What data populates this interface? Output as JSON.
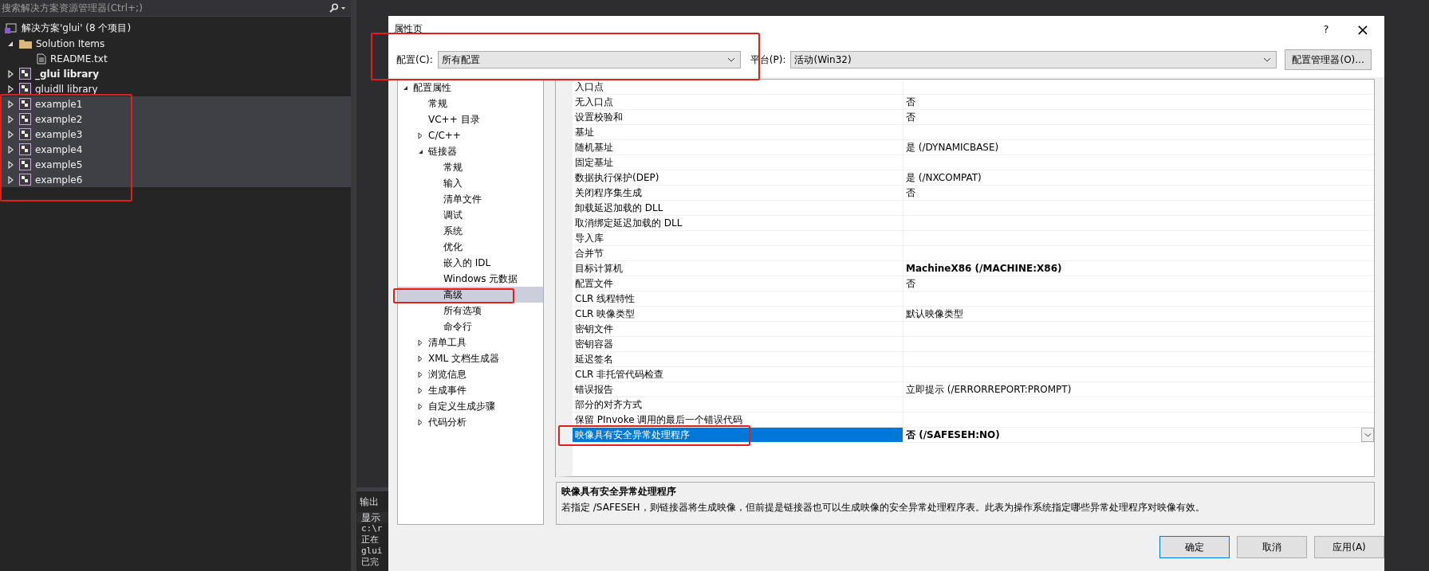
{
  "solution_explorer": {
    "search": {
      "placeholder": "搜索解决方案资源管理器(Ctrl+;)"
    },
    "tree": [
      {
        "label": "解决方案'glui' (8 个项目)",
        "kind": "solution",
        "bold": false,
        "selected": false,
        "children": [
          {
            "label": "Solution Items",
            "kind": "folder",
            "expanded": true,
            "bold": false,
            "selected": false,
            "children": [
              {
                "label": "README.txt",
                "kind": "file",
                "bold": false,
                "selected": false
              }
            ]
          },
          {
            "label": "_glui library",
            "kind": "project",
            "expanded": false,
            "bold": true,
            "selected": false
          },
          {
            "label": "gluidll library",
            "kind": "project",
            "expanded": false,
            "bold": false,
            "selected": false
          },
          {
            "label": "example1",
            "kind": "project",
            "expanded": false,
            "bold": false,
            "selected": true
          },
          {
            "label": "example2",
            "kind": "project",
            "expanded": false,
            "bold": false,
            "selected": true
          },
          {
            "label": "example3",
            "kind": "project",
            "expanded": false,
            "bold": false,
            "selected": true
          },
          {
            "label": "example4",
            "kind": "project",
            "expanded": false,
            "bold": false,
            "selected": true
          },
          {
            "label": "example5",
            "kind": "project",
            "expanded": false,
            "bold": false,
            "selected": true
          },
          {
            "label": "example6",
            "kind": "project",
            "expanded": false,
            "bold": false,
            "selected": true
          }
        ]
      }
    ]
  },
  "output_panel": {
    "title": "输出",
    "lines": [
      "显示",
      "c:\\r",
      "正在",
      "glui",
      "已完"
    ]
  },
  "dialog": {
    "title": "属性页",
    "help": "?",
    "close": "×",
    "configuration": {
      "label": "配置(C):",
      "value": "所有配置"
    },
    "platform": {
      "label": "平台(P):",
      "value": "活动(Win32)"
    },
    "manager_button": "配置管理器(O)...",
    "tree": [
      {
        "label": "配置属性",
        "expanded": true,
        "selected": false,
        "children": [
          {
            "label": "常规",
            "selected": false
          },
          {
            "label": "VC++ 目录",
            "selected": false
          },
          {
            "label": "C/C++",
            "expanded": false,
            "selected": false
          },
          {
            "label": "链接器",
            "expanded": true,
            "selected": false,
            "children": [
              {
                "label": "常规",
                "selected": false
              },
              {
                "label": "输入",
                "selected": false
              },
              {
                "label": "清单文件",
                "selected": false
              },
              {
                "label": "调试",
                "selected": false
              },
              {
                "label": "系统",
                "selected": false
              },
              {
                "label": "优化",
                "selected": false
              },
              {
                "label": "嵌入的 IDL",
                "selected": false
              },
              {
                "label": "Windows 元数据",
                "selected": false
              },
              {
                "label": "高级",
                "selected": true
              },
              {
                "label": "所有选项",
                "selected": false
              },
              {
                "label": "命令行",
                "selected": false
              }
            ]
          },
          {
            "label": "清单工具",
            "expanded": false,
            "selected": false
          },
          {
            "label": "XML 文档生成器",
            "expanded": false,
            "selected": false
          },
          {
            "label": "浏览信息",
            "expanded": false,
            "selected": false
          },
          {
            "label": "生成事件",
            "expanded": false,
            "selected": false
          },
          {
            "label": "自定义生成步骤",
            "expanded": false,
            "selected": false
          },
          {
            "label": "代码分析",
            "expanded": false,
            "selected": false
          }
        ]
      }
    ],
    "properties": [
      {
        "name": "入口点",
        "selected": false
      },
      {
        "name": "无入口点",
        "value": "否",
        "modified": false,
        "selected": false
      },
      {
        "name": "设置校验和",
        "value": "否",
        "modified": false,
        "selected": false
      },
      {
        "name": "基址",
        "selected": false
      },
      {
        "name": "随机基址",
        "value": "是 (/DYNAMICBASE)",
        "modified": false,
        "selected": false
      },
      {
        "name": "固定基址",
        "selected": false
      },
      {
        "name": "数据执行保护(DEP)",
        "value": "是 (/NXCOMPAT)",
        "modified": false,
        "selected": false
      },
      {
        "name": "关闭程序集生成",
        "value": "否",
        "modified": false,
        "selected": false
      },
      {
        "name": "卸载延迟加载的 DLL",
        "selected": false
      },
      {
        "name": "取消绑定延迟加载的 DLL",
        "selected": false
      },
      {
        "name": "导入库",
        "selected": false
      },
      {
        "name": "合并节",
        "selected": false
      },
      {
        "name": "目标计算机",
        "value": "MachineX86 (/MACHINE:X86)",
        "modified": true,
        "selected": false
      },
      {
        "name": "配置文件",
        "value": "否",
        "modified": false,
        "selected": false
      },
      {
        "name": "CLR 线程特性",
        "selected": false
      },
      {
        "name": "CLR 映像类型",
        "value": "默认映像类型",
        "modified": false,
        "selected": false
      },
      {
        "name": "密钥文件",
        "selected": false
      },
      {
        "name": "密钥容器",
        "selected": false
      },
      {
        "name": "延迟签名",
        "selected": false
      },
      {
        "name": "CLR 非托管代码检查",
        "selected": false
      },
      {
        "name": "错误报告",
        "value": "立即提示 (/ERRORREPORT:PROMPT)",
        "modified": false,
        "selected": false
      },
      {
        "name": "部分的对齐方式",
        "selected": false
      },
      {
        "name": "保留 PInvoke 调用的最后一个错误代码",
        "selected": false
      },
      {
        "name": "映像具有安全异常处理程序",
        "value": "否 (/SAFESEH:NO)",
        "modified": true,
        "selected": true
      }
    ],
    "description": {
      "title": "映像具有安全异常处理程序",
      "text": "若指定 /SAFESEH，则链接器将生成映像，但前提是链接器也可以生成映像的安全异常处理程序表。此表为操作系统指定哪些异常处理程序对映像有效。"
    },
    "buttons": [
      "确定",
      "取消",
      "应用(A)"
    ]
  }
}
